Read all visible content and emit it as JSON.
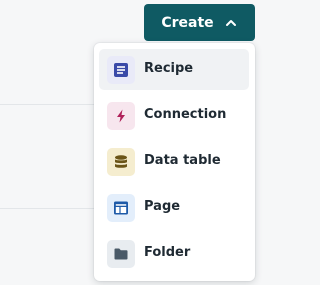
{
  "create_button": {
    "label": "Create",
    "icon": "chevron-up-icon"
  },
  "menu": {
    "items": [
      {
        "label": "Recipe",
        "icon": "recipe-icon",
        "icon_bg": "#e9eaf8",
        "icon_color": "#3a4aa8"
      },
      {
        "label": "Connection",
        "icon": "lightning-icon",
        "icon_bg": "#f7e6ee",
        "icon_color": "#b0215a"
      },
      {
        "label": "Data table",
        "icon": "database-icon",
        "icon_bg": "#f5edcf",
        "icon_color": "#6b5518"
      },
      {
        "label": "Page",
        "icon": "page-layout-icon",
        "icon_bg": "#e3eefb",
        "icon_color": "#1e5aa8"
      },
      {
        "label": "Folder",
        "icon": "folder-icon",
        "icon_bg": "#e8ecf0",
        "icon_color": "#4a5a68"
      }
    ]
  },
  "colors": {
    "accent": "#0f5a63",
    "menu_hover": "#f0f2f4"
  }
}
